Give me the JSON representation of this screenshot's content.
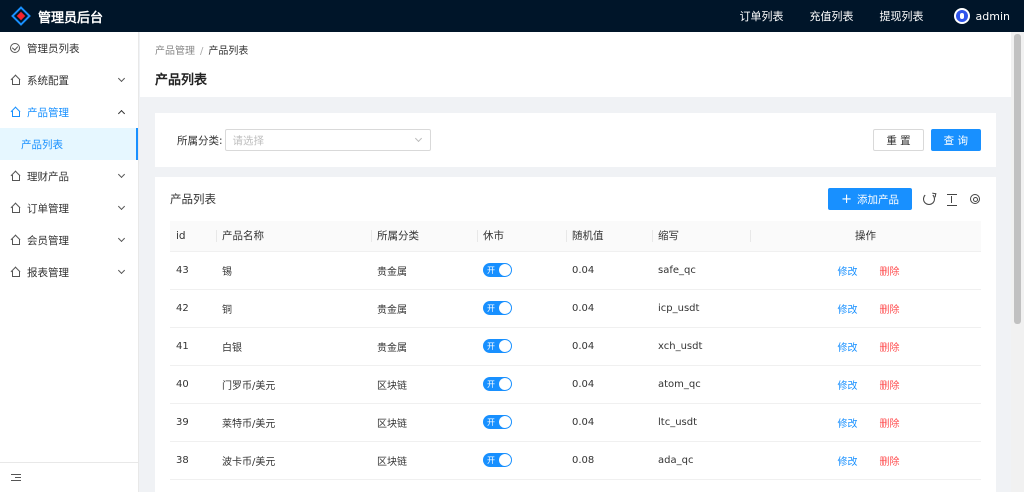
{
  "header": {
    "title": "管理员后台",
    "nav": [
      "订单列表",
      "充值列表",
      "提现列表"
    ],
    "username": "admin"
  },
  "sidebar": {
    "items": [
      {
        "label": "管理员列表"
      },
      {
        "label": "系统配置"
      },
      {
        "label": "产品管理"
      },
      {
        "label": "产品列表"
      },
      {
        "label": "理财产品"
      },
      {
        "label": "订单管理"
      },
      {
        "label": "会员管理"
      },
      {
        "label": "报表管理"
      }
    ]
  },
  "breadcrumb": {
    "parent": "产品管理",
    "separator": "/",
    "current": "产品列表"
  },
  "page": {
    "title": "产品列表"
  },
  "filter": {
    "label": "所属分类:",
    "placeholder": "请选择",
    "reset_label": "重 置",
    "search_label": "查 询"
  },
  "table": {
    "title": "产品列表",
    "add_label": "添加产品",
    "add_icon": "+",
    "columns": [
      "id",
      "产品名称",
      "所属分类",
      "休市",
      "随机值",
      "缩写",
      "操作"
    ],
    "toggle_on_label": "开",
    "edit_label": "修改",
    "delete_label": "删除",
    "rows": [
      {
        "id": "43",
        "name": "锡",
        "category": "贵金属",
        "random": "0.04",
        "abbr": "safe_qc"
      },
      {
        "id": "42",
        "name": "铜",
        "category": "贵金属",
        "random": "0.04",
        "abbr": "icp_usdt"
      },
      {
        "id": "41",
        "name": "白银",
        "category": "贵金属",
        "random": "0.04",
        "abbr": "xch_usdt"
      },
      {
        "id": "40",
        "name": "门罗币/美元",
        "category": "区块链",
        "random": "0.04",
        "abbr": "atom_qc"
      },
      {
        "id": "39",
        "name": "莱特币/美元",
        "category": "区块链",
        "random": "0.04",
        "abbr": "ltc_usdt"
      },
      {
        "id": "38",
        "name": "波卡币/美元",
        "category": "区块链",
        "random": "0.08",
        "abbr": "ada_qc"
      }
    ]
  },
  "colors": {
    "accent": "#1890ff",
    "header_bg": "#001529",
    "danger": "#ff4d4f"
  }
}
